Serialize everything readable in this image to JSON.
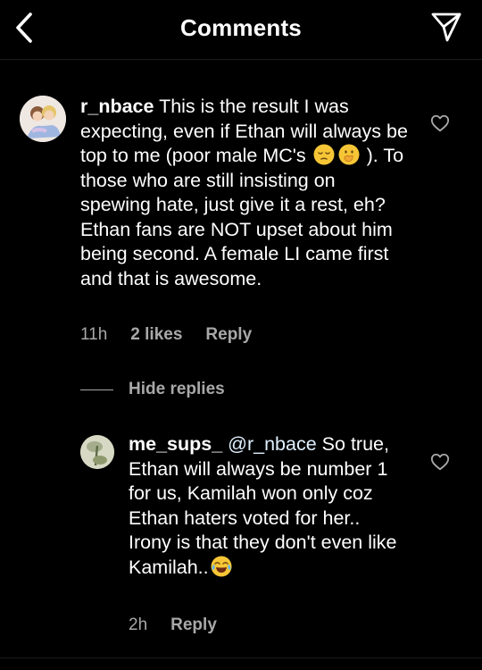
{
  "header": {
    "title": "Comments"
  },
  "comments": [
    {
      "username": "r_nbace",
      "text_1": "This is the result I was expecting, even if Ethan will always be top to me (poor male MC's",
      "text_2": "). To those who are still insisting on spewing hate, just give it a rest, eh? Ethan fans are NOT upset about him being second. A female LI came first and that is awesome.",
      "time": "11h",
      "likes": "2 likes",
      "reply_label": "Reply",
      "emojis": [
        "pensive-face",
        "face-with-hand-over-mouth"
      ]
    }
  ],
  "replies_toggle": {
    "label": "Hide replies"
  },
  "replies": [
    {
      "username": "me_sups_",
      "mention": "@r_nbace",
      "text": "So true, Ethan will always be number 1 for us, Kamilah won only coz Ethan haters voted for her.. Irony is that they don't even like Kamilah..",
      "time": "2h",
      "reply_label": "Reply",
      "emojis": [
        "face-with-tears-of-joy"
      ]
    }
  ],
  "colors": {
    "background": "#000000",
    "primary_text": "#ffffff",
    "secondary_text": "#a8a8a8"
  }
}
